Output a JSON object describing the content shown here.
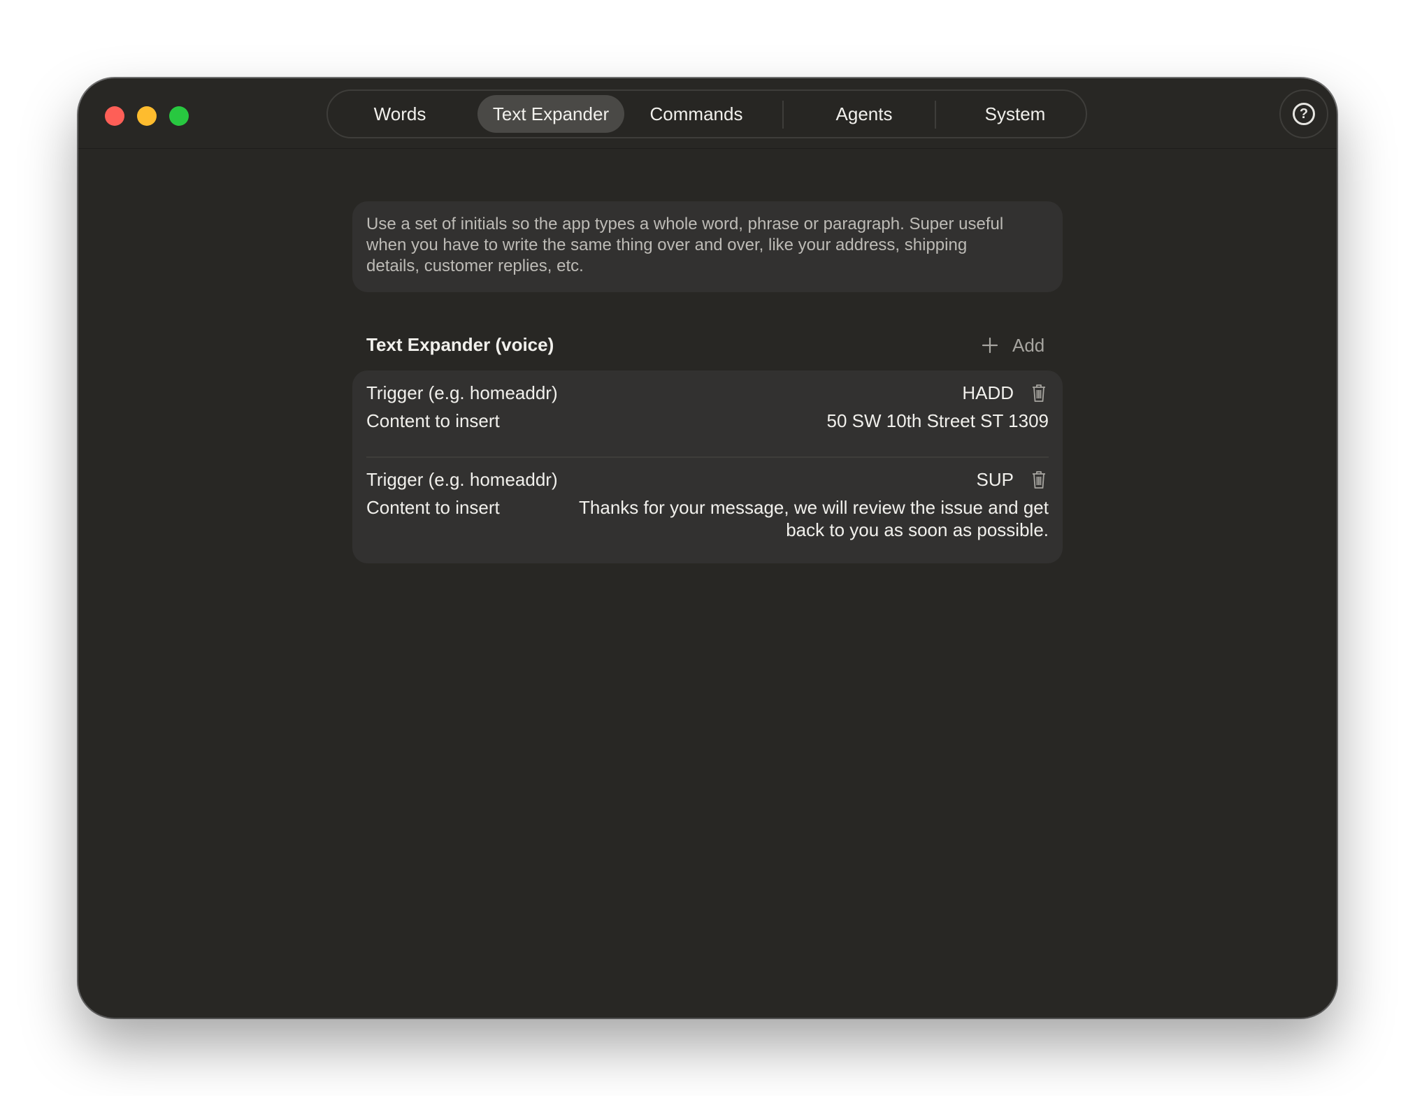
{
  "window": {
    "traffic_lights": {
      "close_color": "#fe5f57",
      "minimize_color": "#febc2e",
      "zoom_color": "#28c840"
    }
  },
  "tabs": [
    {
      "label": "Words"
    },
    {
      "label": "Text Expander",
      "active": true
    },
    {
      "label": "Commands"
    },
    {
      "label": "Agents"
    },
    {
      "label": "System"
    }
  ],
  "help": {
    "icon": "question-circle-icon",
    "glyph": "?"
  },
  "info": {
    "line1": "Use a set of initials so the app types a whole word, phrase or paragraph. Super useful",
    "line2": "when you have to write the same thing over and over, like your address, shipping",
    "line3": "details, customer replies, etc."
  },
  "section": {
    "title": "Text Expander (voice)",
    "add_label": "Add",
    "add_icon": "plus-icon"
  },
  "entries": [
    {
      "trigger_label": "Trigger (e.g. homeaddr)",
      "trigger_value": "HADD",
      "content_label": "Content to insert",
      "content_value_line1": "50 SW 10th Street ST 1309",
      "content_value_line2": "",
      "delete_icon": "trash-icon"
    },
    {
      "trigger_label": "Trigger (e.g. homeaddr)",
      "trigger_value": "SUP",
      "content_label": "Content to insert",
      "content_value_line1": "Thanks for your message, we will review the issue and get",
      "content_value_line2": "back to you as soon as possible.",
      "delete_icon": "trash-icon"
    }
  ]
}
